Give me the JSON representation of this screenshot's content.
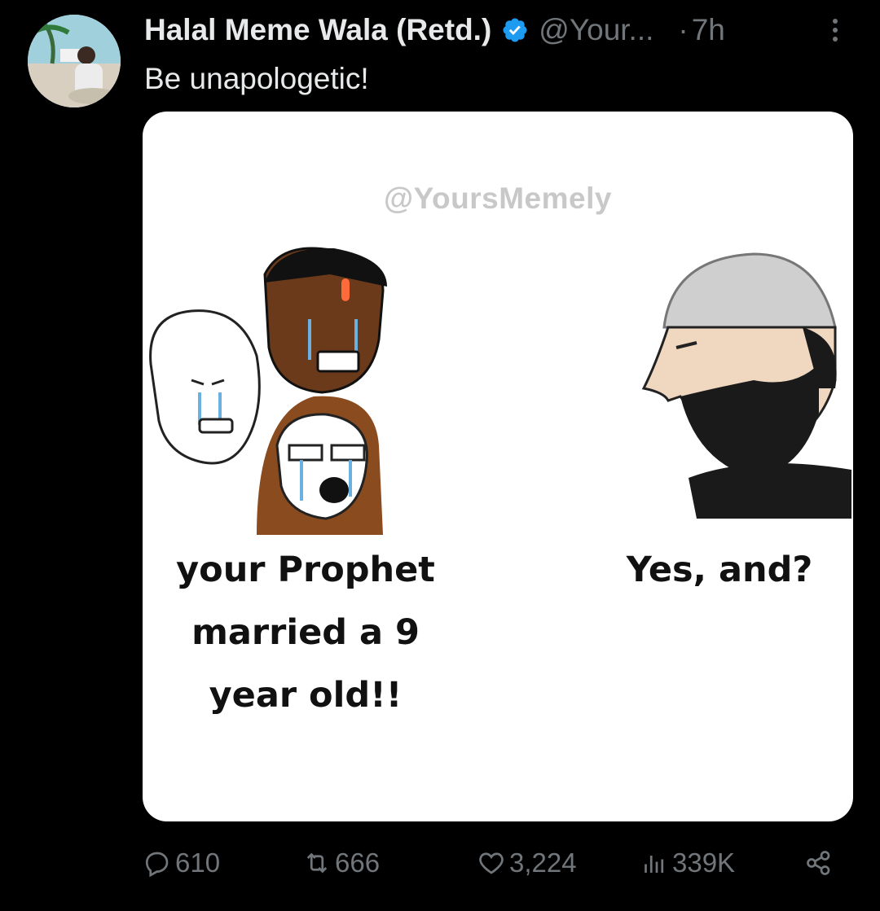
{
  "tweet": {
    "display_name": "Halal Meme Wala (Retd.)",
    "handle": "@Your...",
    "separator": "·",
    "time": "7h",
    "text": "Be unapologetic!"
  },
  "media": {
    "watermark": "@YoursMemely",
    "left_caption": "your Prophet married a 9 year old!!",
    "right_caption": "Yes, and?"
  },
  "actions": {
    "replies": "610",
    "reposts": "666",
    "likes": "3,224",
    "views": "339K"
  },
  "colors": {
    "background": "#000000",
    "text": "#e7e9ea",
    "muted": "#71767b",
    "verified": "#1d9bf0"
  }
}
